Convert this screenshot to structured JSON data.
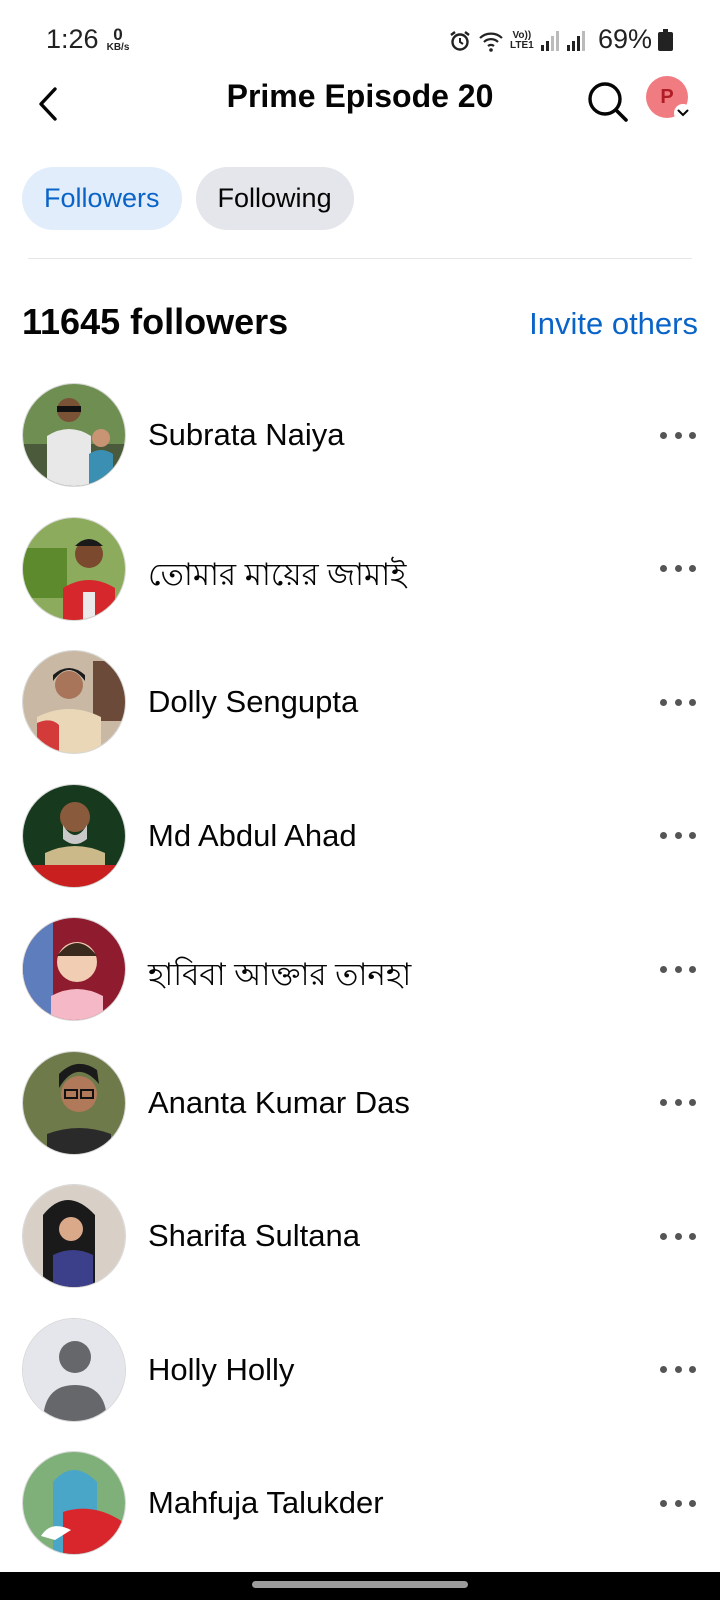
{
  "status_bar": {
    "time": "1:26",
    "net_speed": "0",
    "net_speed_unit": "KB/s",
    "volte_line1": "Vo))",
    "volte_line2": "LTE1",
    "battery": "69%"
  },
  "header": {
    "title": "Prime Episode 20",
    "avatar_initial": "P"
  },
  "tabs": [
    {
      "label": "Followers",
      "active": true
    },
    {
      "label": "Following",
      "active": false
    }
  ],
  "section": {
    "count_title": "11645 followers",
    "invite_label": "Invite others"
  },
  "followers": [
    {
      "name": "Subrata Naiya"
    },
    {
      "name": "তোমার মায়ের জামাই"
    },
    {
      "name": "Dolly Sengupta"
    },
    {
      "name": "Md Abdul Ahad"
    },
    {
      "name": "হাবিবা আক্তার তানহা"
    },
    {
      "name": "Ananta Kumar Das"
    },
    {
      "name": "Sharifa Sultana"
    },
    {
      "name": "Holly Holly"
    },
    {
      "name": "Mahfuja Talukder"
    }
  ],
  "colors": {
    "accent": "#0a64c8",
    "active_tab_bg": "#e1edfb",
    "inactive_tab_bg": "#e4e6eb"
  }
}
